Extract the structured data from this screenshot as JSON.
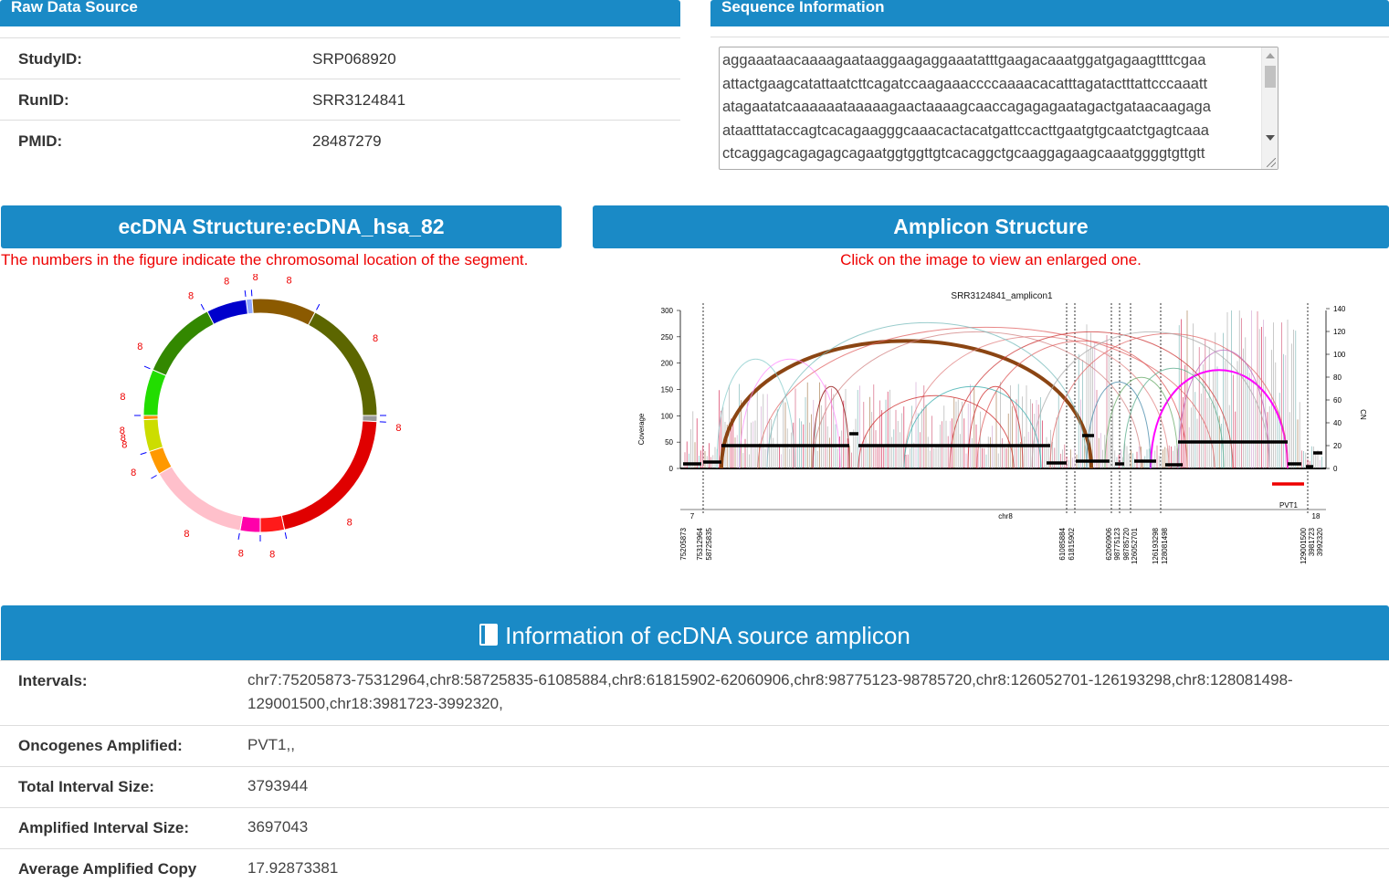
{
  "raw": {
    "title": "Raw Data Source",
    "rows": [
      {
        "key": "StudyID:",
        "value": "SRP068920"
      },
      {
        "key": "RunID:",
        "value": "SRR3124841"
      },
      {
        "key": "PMID:",
        "value": "28487279"
      }
    ]
  },
  "seq": {
    "title": "Sequence Information",
    "lines": [
      "aggaaataacaaaagaataaggaagaggaaatatttgaagacaaatggatgagaagttttcgaa",
      "attactgaagcatattaatcttcagatccaagaaaccccaaaacacatttagatactttattcccaaatt",
      "atagaatatcaaaaaataaaaagaactaaaagcaaccagagagaatagactgataacaagaga",
      "ataatttataccagtcacagaagggcaaacactacatgattccacttgaatgtgcaatctgagtcaaa",
      "ctcaggagcagagagcagaatggtggttgtcacaggctgcaaggagaagcaaatggggtgttgtt"
    ]
  },
  "structure": {
    "title": "ecDNA Structure:ecDNA_hsa_82",
    "note": "The numbers in the figure indicate the chromosomal location of the segment.",
    "segment_label": "8"
  },
  "amplicon": {
    "title": "Amplicon Structure",
    "note": "Click on the image to view an enlarged one.",
    "plot_title": "SRR3124841_amplicon1",
    "ylabel_left": "Coverage",
    "ylabel_right": "CN",
    "left_ticks": [
      "300",
      "250",
      "200",
      "150",
      "100",
      "50",
      "0"
    ],
    "right_ticks": [
      "140",
      "120",
      "100",
      "80",
      "60",
      "40",
      "20",
      "0"
    ],
    "chr_labels": [
      "7",
      "chr8",
      "18"
    ],
    "gene": "PVT1",
    "positions": [
      "75205873",
      "75312964",
      "58725835",
      "61085884",
      "61815902",
      "62060906",
      "98775123",
      "98785720",
      "126052701",
      "126193298",
      "128081498",
      "129001500",
      "3981723",
      "3992320"
    ]
  },
  "info": {
    "title": "Information of ecDNA source amplicon",
    "rows": [
      {
        "key": "Intervals:",
        "value": "chr7:75205873-75312964,chr8:58725835-61085884,chr8:61815902-62060906,chr8:98775123-98785720,chr8:126052701-126193298,chr8:128081498-",
        "value2": "129001500,chr18:3981723-3992320,"
      },
      {
        "key": "Oncogenes Amplified:",
        "value": "PVT1,,"
      },
      {
        "key": "Total Interval Size:",
        "value": "3793944"
      },
      {
        "key": "Amplified Interval Size:",
        "value": "3697043"
      },
      {
        "key": "Average Amplified Copy",
        "value": "17.92873381"
      }
    ]
  },
  "colors": {
    "header": "#1a8ac6",
    "note": "#e00000"
  }
}
